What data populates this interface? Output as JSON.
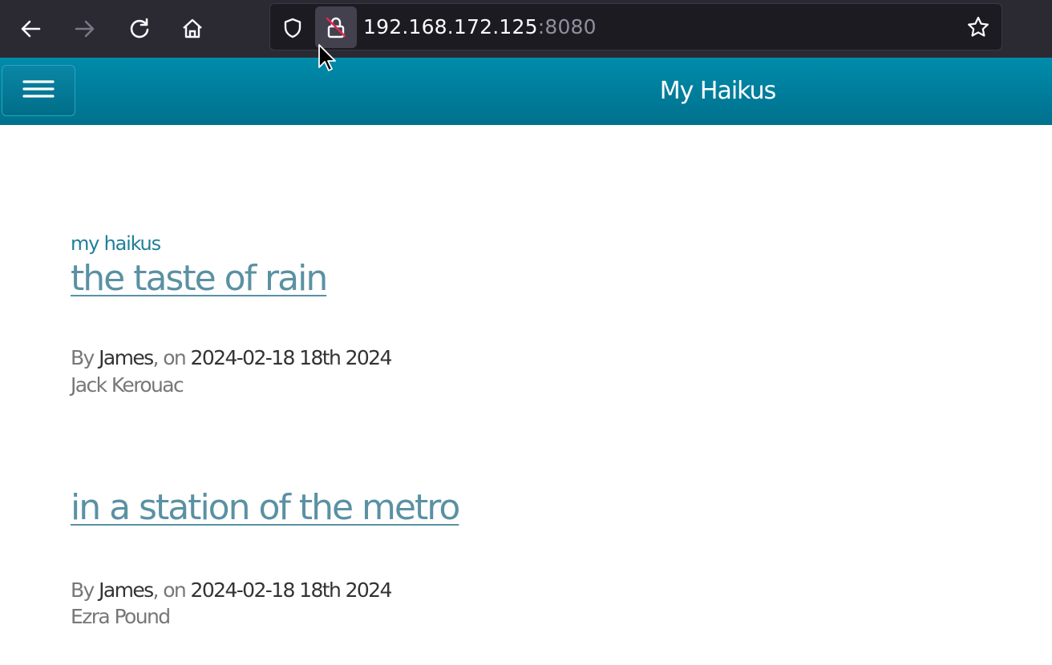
{
  "browser": {
    "url_host": "192.168.172.125",
    "url_port": ":8080"
  },
  "header": {
    "title": "My Haikus"
  },
  "main": {
    "section_label": "my haikus",
    "posts": [
      {
        "title": "the taste of rain",
        "by_prefix": "By ",
        "author_name": "James",
        "on_text": ", on ",
        "date": "2024-02-18 18th 2024",
        "attribution": "Jack Kerouac"
      },
      {
        "title": "in a station of the metro",
        "by_prefix": "By ",
        "author_name": "James",
        "on_text": ", on ",
        "date": "2024-02-18 18th 2024",
        "attribution": "Ezra Pound"
      }
    ]
  },
  "colors": {
    "header_bg": "#00819f",
    "link": "#5a91a3",
    "section_label": "#1f7f99"
  },
  "icons": [
    "back-icon",
    "forward-icon",
    "reload-icon",
    "home-icon",
    "shield-icon",
    "insecure-lock-icon",
    "star-icon",
    "hamburger-icon",
    "cursor-icon"
  ]
}
